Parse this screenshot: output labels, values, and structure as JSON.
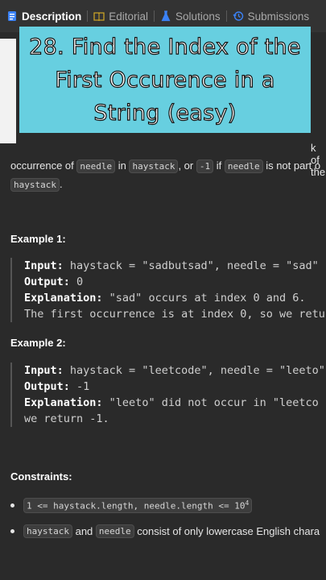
{
  "tabs": [
    {
      "label": "Description",
      "icon": "document-icon",
      "active": true
    },
    {
      "label": "Editorial",
      "icon": "book-icon",
      "active": false
    },
    {
      "label": "Solutions",
      "icon": "flask-icon",
      "active": false
    },
    {
      "label": "Submissions",
      "icon": "history-icon",
      "active": false
    }
  ],
  "banner": {
    "title": "28. Find the Index of the First Occurence in a String (easy)"
  },
  "description": {
    "partial_right": "k of the",
    "line1_a": "occurrence of ",
    "needle": "needle",
    "line1_b": " in ",
    "haystack": "haystack",
    "line1_c": ", or ",
    "minus_one": "-1",
    "line1_d": " if ",
    "line1_e": " is not part o",
    "line2_end": "."
  },
  "example1": {
    "heading": "Example 1:",
    "input_label": "Input:",
    "input_value": " haystack = \"sadbutsad\", needle = \"sad\"",
    "output_label": "Output:",
    "output_value": " 0",
    "explanation_label": "Explanation:",
    "explanation_value": " \"sad\" occurs at index 0 and 6.",
    "explanation_line2": "The first occurrence is at index 0, so we retu"
  },
  "example2": {
    "heading": "Example 2:",
    "input_label": "Input:",
    "input_value": " haystack = \"leetcode\", needle = \"leeto\"",
    "output_label": "Output:",
    "output_value": " -1",
    "explanation_label": "Explanation:",
    "explanation_value": " \"leeto\" did not occur in \"leetco",
    "explanation_line2": "we return -1."
  },
  "constraints": {
    "heading": "Constraints:",
    "item1_code": "1 <= haystack.length, needle.length <= 10",
    "item1_sup": "4",
    "item2_code_a": "haystack",
    "item2_text_a": " and ",
    "item2_code_b": "needle",
    "item2_text_b": " consist of only lowercase English chara"
  }
}
